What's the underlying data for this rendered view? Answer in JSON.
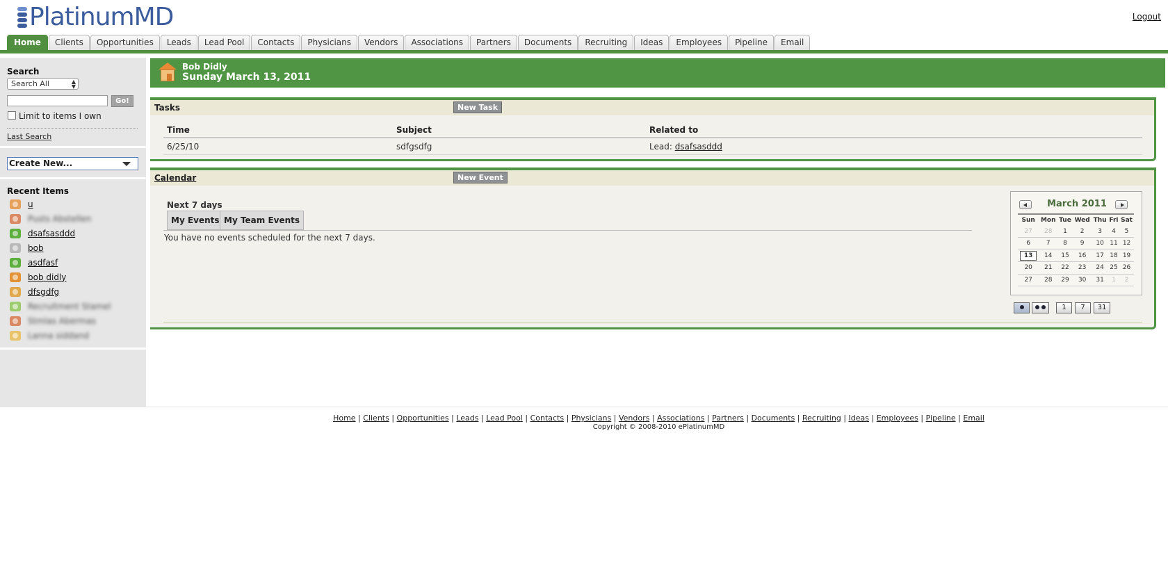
{
  "header": {
    "logo_text": "PlatinumMD",
    "logout_label": "Logout"
  },
  "tabs": [
    {
      "label": "Home",
      "active": true
    },
    {
      "label": "Clients"
    },
    {
      "label": "Opportunities"
    },
    {
      "label": "Leads"
    },
    {
      "label": "Lead Pool"
    },
    {
      "label": "Contacts"
    },
    {
      "label": "Physicians"
    },
    {
      "label": "Vendors"
    },
    {
      "label": "Associations"
    },
    {
      "label": "Partners"
    },
    {
      "label": "Documents"
    },
    {
      "label": "Recruiting"
    },
    {
      "label": "Ideas"
    },
    {
      "label": "Employees"
    },
    {
      "label": "Pipeline"
    },
    {
      "label": "Email"
    }
  ],
  "sidebar": {
    "search_label": "Search",
    "search_scope": "Search All",
    "search_value": "",
    "go_label": "Go!",
    "limit_label": "Limit to items I own",
    "last_search_label": "Last Search",
    "create_new_label": "Create New...",
    "recent_label": "Recent Items",
    "recent_items": [
      {
        "label": "u",
        "icon": "client-icon",
        "color": "#e7a05a",
        "blurred": false
      },
      {
        "label": "Pusts Abstellen",
        "icon": "opportunity-icon",
        "color": "#d98a64",
        "blurred": true
      },
      {
        "label": "dsafsasddd",
        "icon": "lead-icon",
        "color": "#5cae3d",
        "blurred": false
      },
      {
        "label": "bob",
        "icon": "contact-icon",
        "color": "#b9b9b9",
        "blurred": false
      },
      {
        "label": "asdfasf",
        "icon": "lead-icon",
        "color": "#5cae3d",
        "blurred": false
      },
      {
        "label": "bob didly",
        "icon": "employee-icon",
        "color": "#e39235",
        "blurred": false
      },
      {
        "label": "dfsgdfg",
        "icon": "task-icon",
        "color": "#e0a84a",
        "blurred": false
      },
      {
        "label": "Recruitment Stamel",
        "icon": "document-icon",
        "color": "#9ccc6d",
        "blurred": true
      },
      {
        "label": "Stmlas Abermas",
        "icon": "opportunity-icon",
        "color": "#d98a64",
        "blurred": true
      },
      {
        "label": "Lanna siddand",
        "icon": "note-icon",
        "color": "#e8c36a",
        "blurred": true
      }
    ]
  },
  "main": {
    "user_name": "Bob Didly",
    "date": "Sunday March 13, 2011"
  },
  "tasks": {
    "title": "Tasks",
    "new_button": "New Task",
    "columns": [
      "Time",
      "Subject",
      "Related to"
    ],
    "rows": [
      {
        "time": "6/25/10",
        "subject": "sdfgsdfg",
        "related_prefix": "Lead: ",
        "related_link": "dsafsasddd"
      }
    ]
  },
  "calendar": {
    "title": "Calendar",
    "new_button": "New Event",
    "next_label": "Next 7 days",
    "tab_my": "My Events",
    "tab_team": "My Team Events",
    "empty_message": "You have no events scheduled for the next 7 days.",
    "mini": {
      "title": "March 2011",
      "weekdays": [
        "Sun",
        "Mon",
        "Tue",
        "Wed",
        "Thu",
        "Fri",
        "Sat"
      ],
      "weeks": [
        [
          {
            "d": "27",
            "o": true
          },
          {
            "d": "28",
            "o": true
          },
          {
            "d": "1"
          },
          {
            "d": "2"
          },
          {
            "d": "3"
          },
          {
            "d": "4"
          },
          {
            "d": "5"
          }
        ],
        [
          {
            "d": "6"
          },
          {
            "d": "7"
          },
          {
            "d": "8"
          },
          {
            "d": "9"
          },
          {
            "d": "10"
          },
          {
            "d": "11"
          },
          {
            "d": "12"
          }
        ],
        [
          {
            "d": "13",
            "today": true
          },
          {
            "d": "14"
          },
          {
            "d": "15"
          },
          {
            "d": "16"
          },
          {
            "d": "17"
          },
          {
            "d": "18"
          },
          {
            "d": "19"
          }
        ],
        [
          {
            "d": "20"
          },
          {
            "d": "21"
          },
          {
            "d": "22"
          },
          {
            "d": "23"
          },
          {
            "d": "24"
          },
          {
            "d": "25"
          },
          {
            "d": "26"
          }
        ],
        [
          {
            "d": "27"
          },
          {
            "d": "28"
          },
          {
            "d": "29"
          },
          {
            "d": "30"
          },
          {
            "d": "31"
          },
          {
            "d": "1",
            "o": true
          },
          {
            "d": "2",
            "o": true
          }
        ]
      ],
      "view_buttons": [
        "1",
        "7",
        "31"
      ]
    }
  },
  "footer": {
    "links": [
      "Home",
      "Clients",
      "Opportunities",
      "Leads",
      "Lead Pool",
      "Contacts",
      "Physicians",
      "Vendors",
      "Associations",
      "Partners",
      "Documents",
      "Recruiting",
      "Ideas",
      "Employees",
      "Pipeline",
      "Email"
    ],
    "copyright": "Copyright © 2008-2010 ePlatinumMD"
  }
}
